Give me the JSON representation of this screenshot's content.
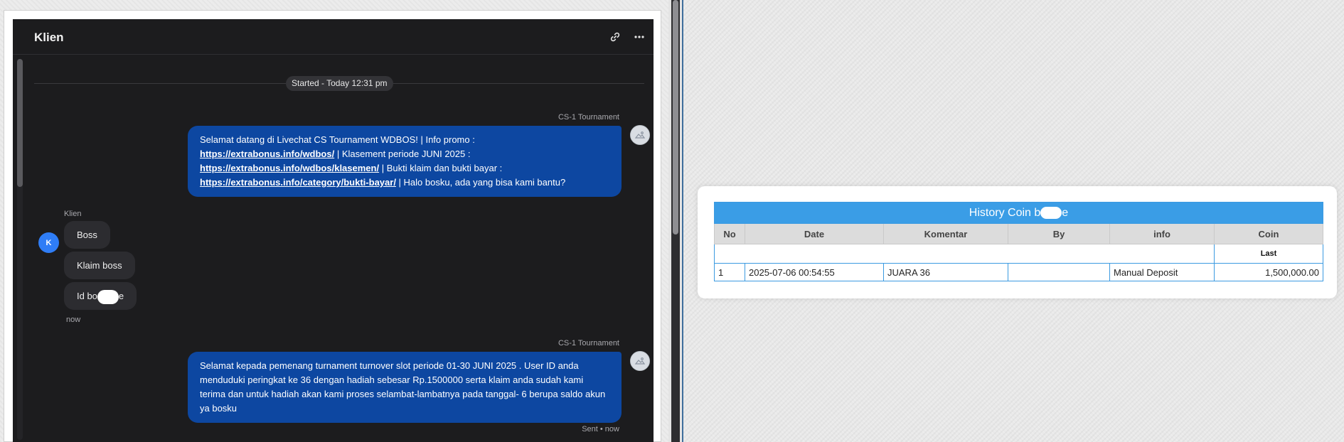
{
  "chat": {
    "title": "Klien",
    "started_label": "Started - Today 12:31 pm",
    "agent_name": "CS-1 Tournament",
    "messages": {
      "m1": {
        "p1": "Selamat datang di Livechat CS Tournament WDBOS! | Info promo :",
        "link1": "https://extrabonus.info/wdbos/",
        "p2": " | Klasement periode JUNI 2025 :",
        "link2": "https://extrabonus.info/wdbos/klasemen/",
        "p3": " | Bukti klaim dan bukti bayar :",
        "link3": "https://extrabonus.info/category/bukti-bayar/",
        "p4": " | Halo bosku, ada yang bisa kami bantu?"
      },
      "m2": "Selamat kepada pemenang turnament turnover slot periode 01-30 JUNI 2025 . User ID anda menduduki peringkat ke 36 dengan hadiah sebesar Rp.1500000 serta klaim anda sudah kami terima dan untuk hadiah akan kami proses selambat-lambatnya pada tanggal- 6 berupa saldo akun ya bosku"
    },
    "client": {
      "name": "Klien",
      "initial": "K",
      "bubbles": {
        "b1": "Boss",
        "b2": "Klaim boss",
        "b3_prefix": "Id bo",
        "b3_suffix": "e"
      },
      "time": "now"
    },
    "sent_status": "Sent • now"
  },
  "history": {
    "title_prefix": "History Coin b",
    "title_suffix": "e",
    "columns": {
      "no": "No",
      "date": "Date",
      "komentar": "Komentar",
      "by": "By",
      "info": "info",
      "coin": "Coin"
    },
    "subheader": "Last",
    "row": {
      "no": "1",
      "date": "2025-07-06 00:54:55",
      "komentar": "JUARA 36",
      "by": "",
      "info": "Manual Deposit",
      "coin": "1,500,000.00"
    }
  },
  "colors": {
    "agent_bubble": "#0d47a1",
    "client_avatar": "#2f7df6",
    "table_header": "#3a9de6",
    "coin_value": "#1a8a1a"
  },
  "icons": [
    "link-icon",
    "more-horizontal-icon",
    "agent-avatar-icon"
  ]
}
